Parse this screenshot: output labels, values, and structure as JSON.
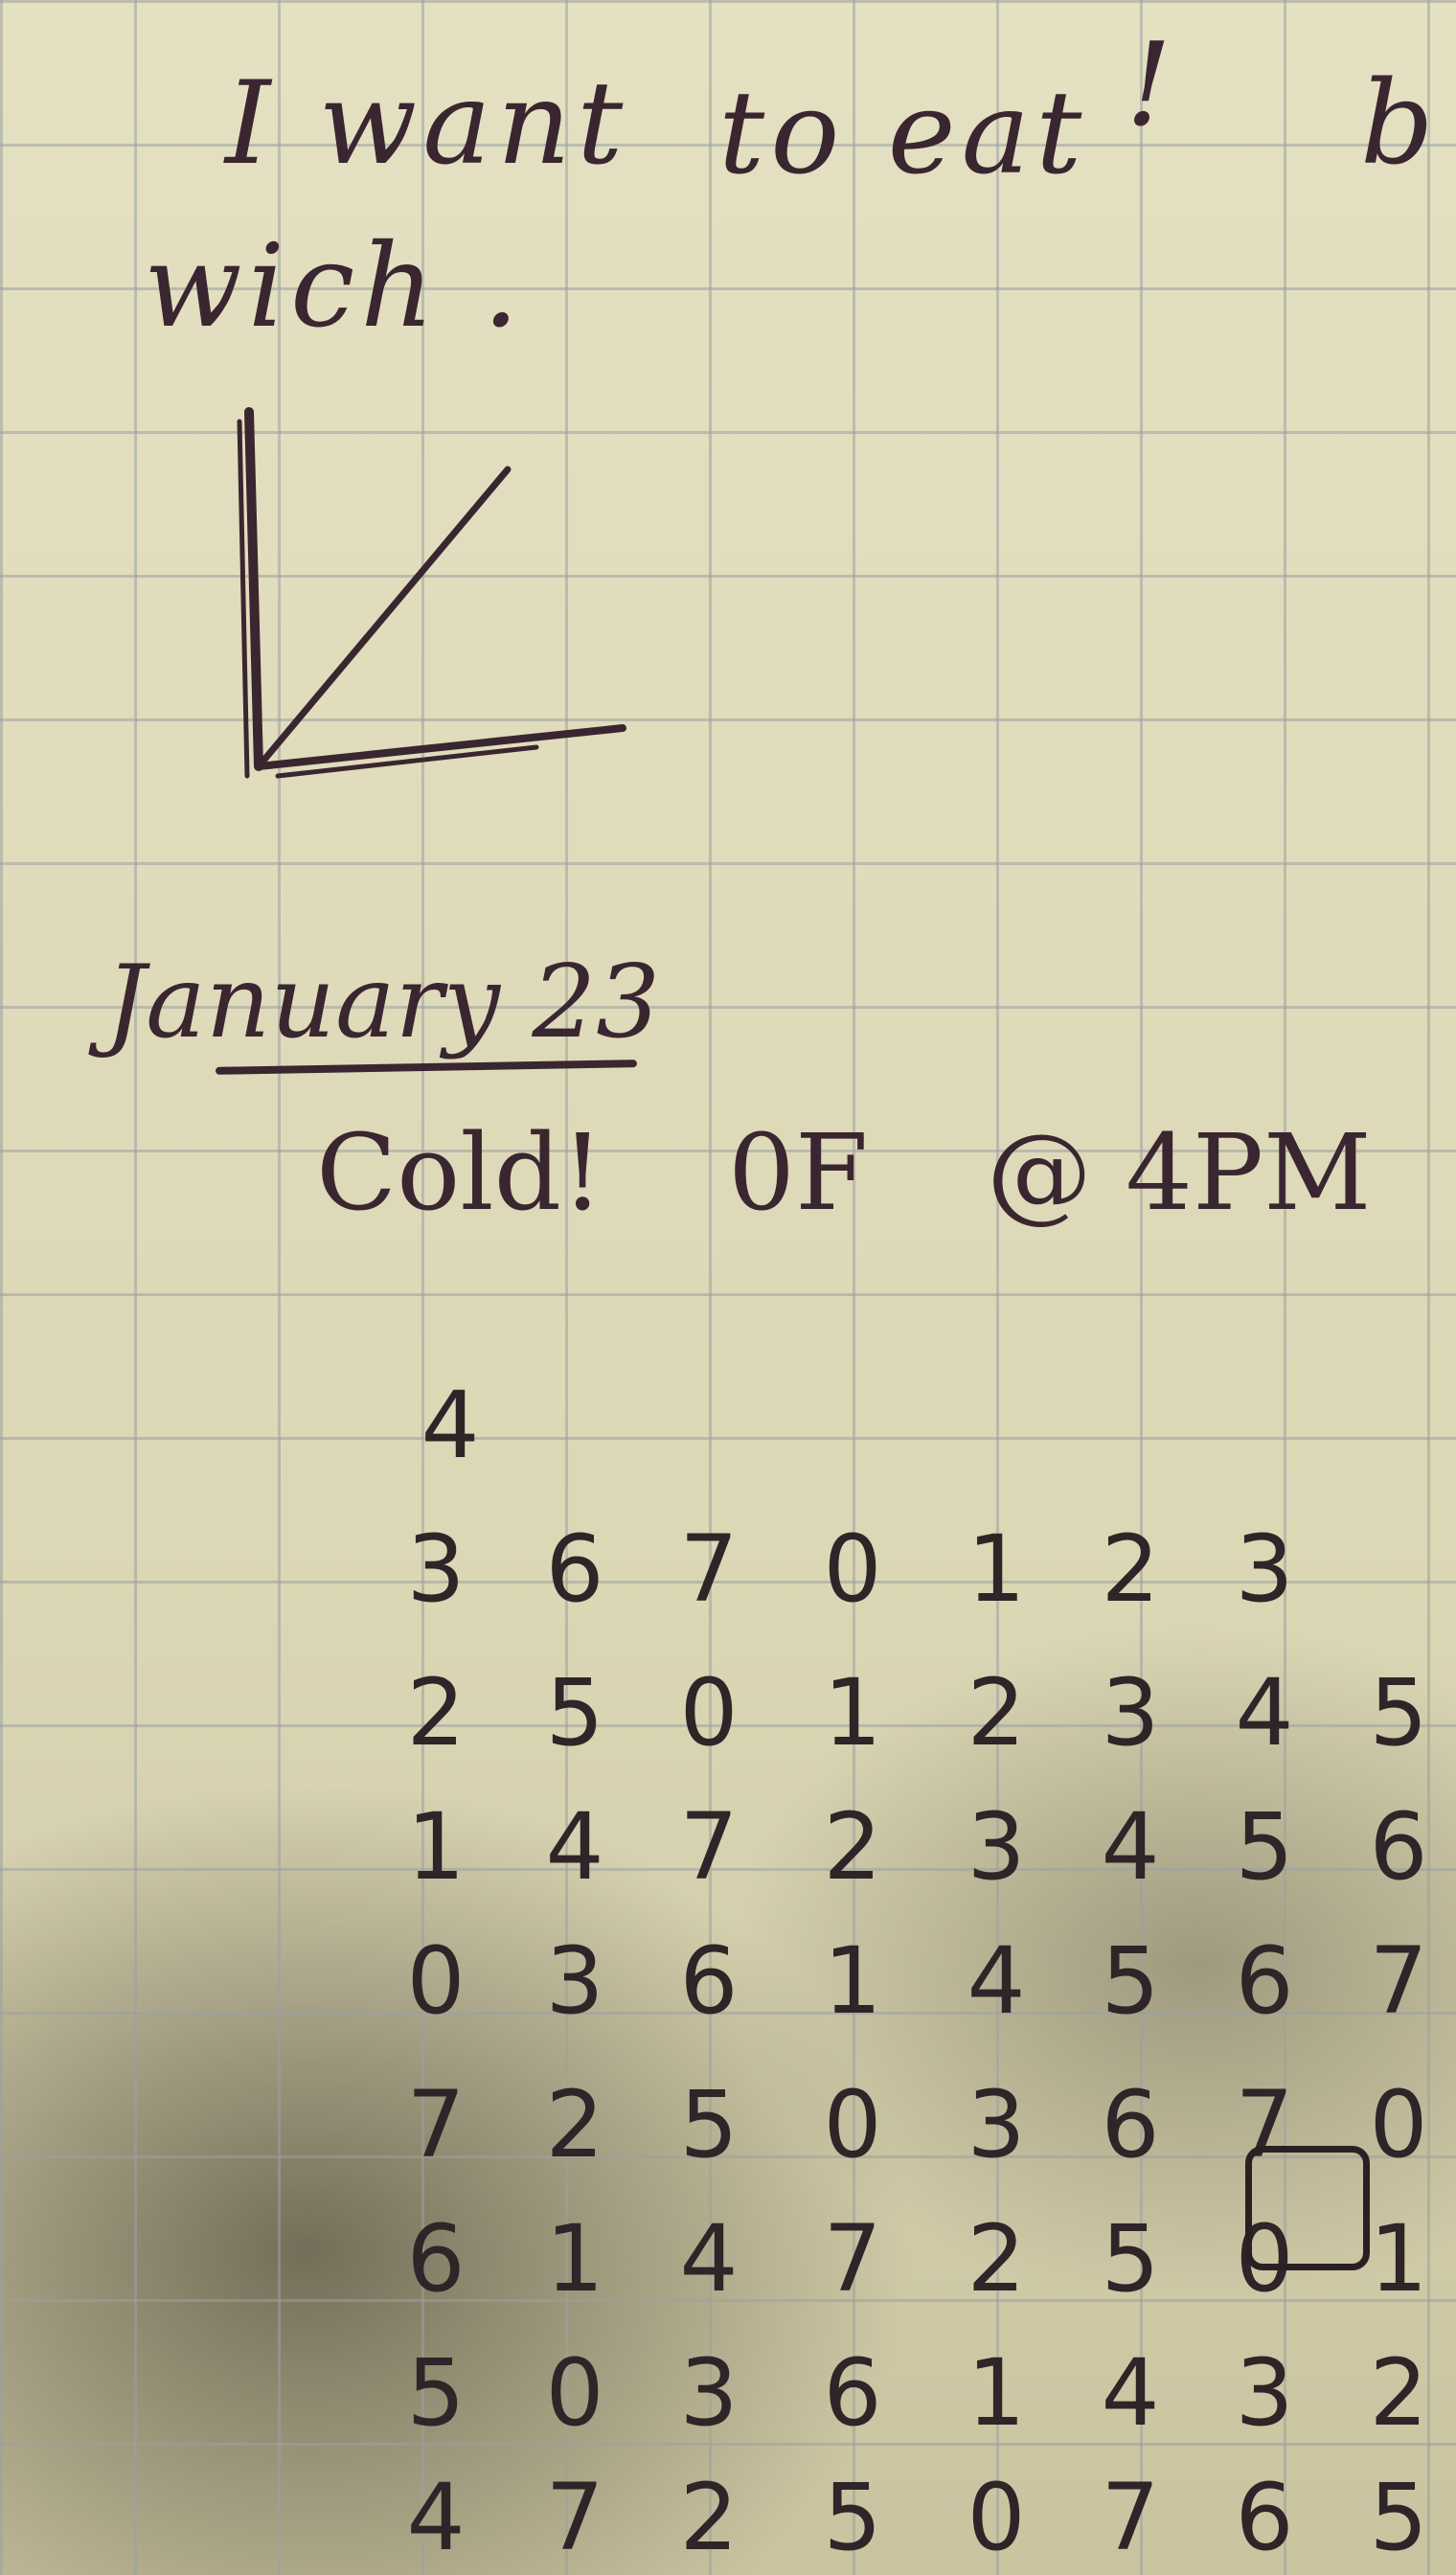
{
  "note": {
    "line1_word1": "I want",
    "line1_word2": "to eat",
    "line1_word3": "!",
    "line1_word4": "b",
    "line2": "wich ."
  },
  "entry": {
    "date": "January 23",
    "weather": "Cold!",
    "temperature": "0F",
    "time": "@ 4PM"
  },
  "digit_grid": {
    "col0_top": "4",
    "rows": [
      [
        "3",
        "6",
        "7",
        "0",
        "1",
        "2",
        "3"
      ],
      [
        "2",
        "5",
        "0",
        "1",
        "2",
        "3",
        "4",
        "5"
      ],
      [
        "1",
        "4",
        "7",
        "2",
        "3",
        "4",
        "5",
        "6"
      ],
      [
        "0",
        "3",
        "6",
        "1",
        "4",
        "5",
        "6",
        "7"
      ],
      [
        "7",
        "2",
        "5",
        "0",
        "3",
        "6",
        "7",
        "0"
      ],
      [
        "6",
        "1",
        "4",
        "7",
        "2",
        "5",
        "0",
        "1"
      ],
      [
        "5",
        "0",
        "3",
        "6",
        "1",
        "4",
        "3",
        "2"
      ],
      [
        "4",
        "7",
        "2",
        "5",
        "0",
        "7",
        "6",
        "5"
      ]
    ]
  },
  "colors": {
    "paper": "#ddd8b6",
    "grid": "#9ba0a0",
    "ink": "#3a2630"
  }
}
